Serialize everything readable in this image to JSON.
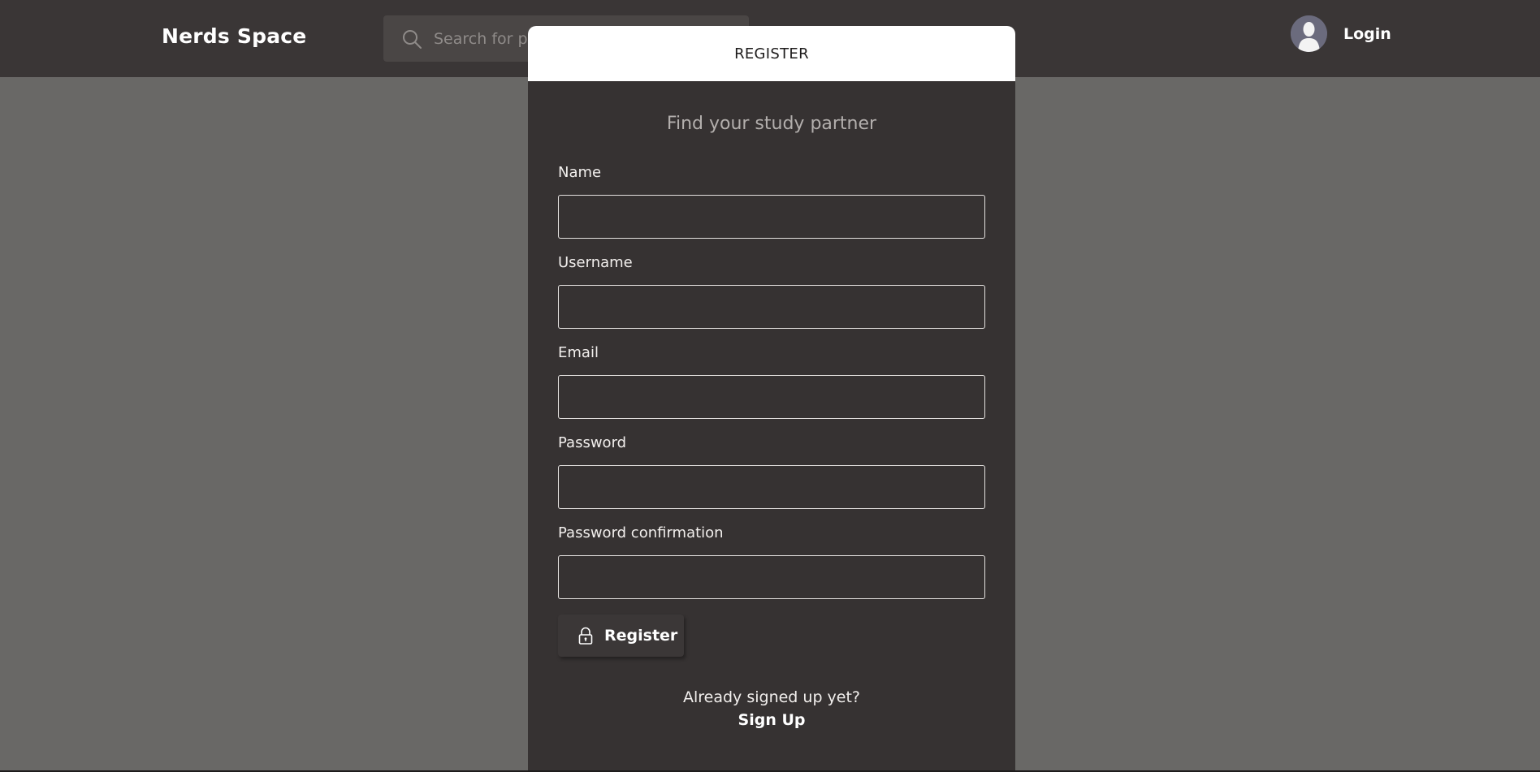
{
  "header": {
    "brand": "Nerds Space",
    "search_placeholder": "Search for posts...",
    "login_label": "Login"
  },
  "modal": {
    "title": "REGISTER",
    "tagline": "Find your study partner",
    "fields": [
      {
        "label": "Name",
        "value": ""
      },
      {
        "label": "Username",
        "value": ""
      },
      {
        "label": "Email",
        "value": ""
      },
      {
        "label": "Password",
        "value": ""
      },
      {
        "label": "Password confirmation",
        "value": ""
      }
    ],
    "submit_label": "Register",
    "footer_text": "Already signed up yet?",
    "footer_link": "Sign Up"
  },
  "colors": {
    "topbar": "#3a3636",
    "backdrop": "#696866",
    "modal": "#363232",
    "modal_header": "#ffffff"
  },
  "icons": {
    "search": "search-icon",
    "avatar": "user-avatar-icon",
    "lock": "lock-icon"
  }
}
